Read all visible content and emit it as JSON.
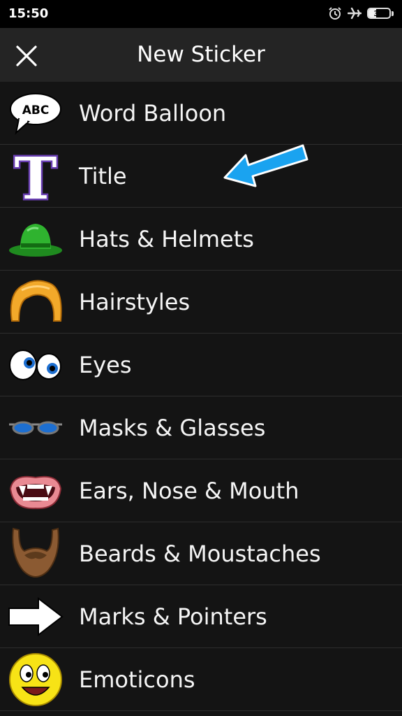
{
  "status_bar": {
    "time": "15:50",
    "battery_text": "36",
    "battery_level": 0.36,
    "icons": [
      "alarm-icon",
      "airplane-icon",
      "battery-icon"
    ]
  },
  "app_bar": {
    "title": "New Sticker",
    "close_icon": "close-icon"
  },
  "categories": [
    {
      "label": "Word Balloon",
      "icon": "word-balloon-icon",
      "icon_text": "ABC"
    },
    {
      "label": "Title",
      "icon": "title-icon",
      "icon_text": "T"
    },
    {
      "label": "Hats & Helmets",
      "icon": "hat-icon"
    },
    {
      "label": "Hairstyles",
      "icon": "hairstyle-icon"
    },
    {
      "label": "Eyes",
      "icon": "eyes-icon"
    },
    {
      "label": "Masks & Glasses",
      "icon": "glasses-icon"
    },
    {
      "label": "Ears, Nose & Mouth",
      "icon": "mouth-icon"
    },
    {
      "label": "Beards & Moustaches",
      "icon": "beard-icon"
    },
    {
      "label": "Marks & Pointers",
      "icon": "pointer-arrow-icon"
    },
    {
      "label": "Emoticons",
      "icon": "emoticon-icon"
    }
  ],
  "colors": {
    "background": "#141414",
    "app_bar": "#242424",
    "status_bar": "#000000",
    "annotation_arrow": "#1aa3f0"
  }
}
